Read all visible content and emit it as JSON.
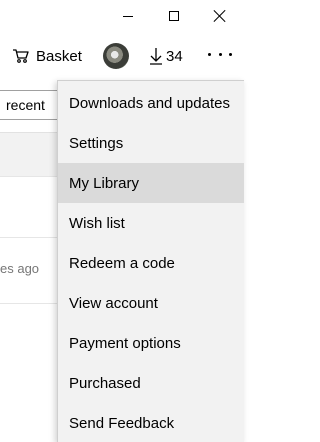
{
  "window": {
    "minimize_icon": "minimize-icon",
    "maximize_icon": "maximize-icon",
    "close_icon": "close-icon"
  },
  "toolbar": {
    "basket_label": "Basket",
    "basket_icon": "cart-icon",
    "download_count": "34",
    "download_icon": "download-arrow-icon",
    "more_icon": "ellipsis-icon"
  },
  "background": {
    "sort_value": "recent",
    "time_fragment": "es ago"
  },
  "menu": {
    "items": [
      {
        "label": "Downloads and updates"
      },
      {
        "label": "Settings"
      },
      {
        "label": "My Library"
      },
      {
        "label": "Wish list"
      },
      {
        "label": "Redeem a code"
      },
      {
        "label": "View account"
      },
      {
        "label": "Payment options"
      },
      {
        "label": "Purchased"
      },
      {
        "label": "Send Feedback"
      }
    ],
    "active_index": 2,
    "colors": {
      "background": "#f2f2f2",
      "hover": "#dadada"
    }
  }
}
